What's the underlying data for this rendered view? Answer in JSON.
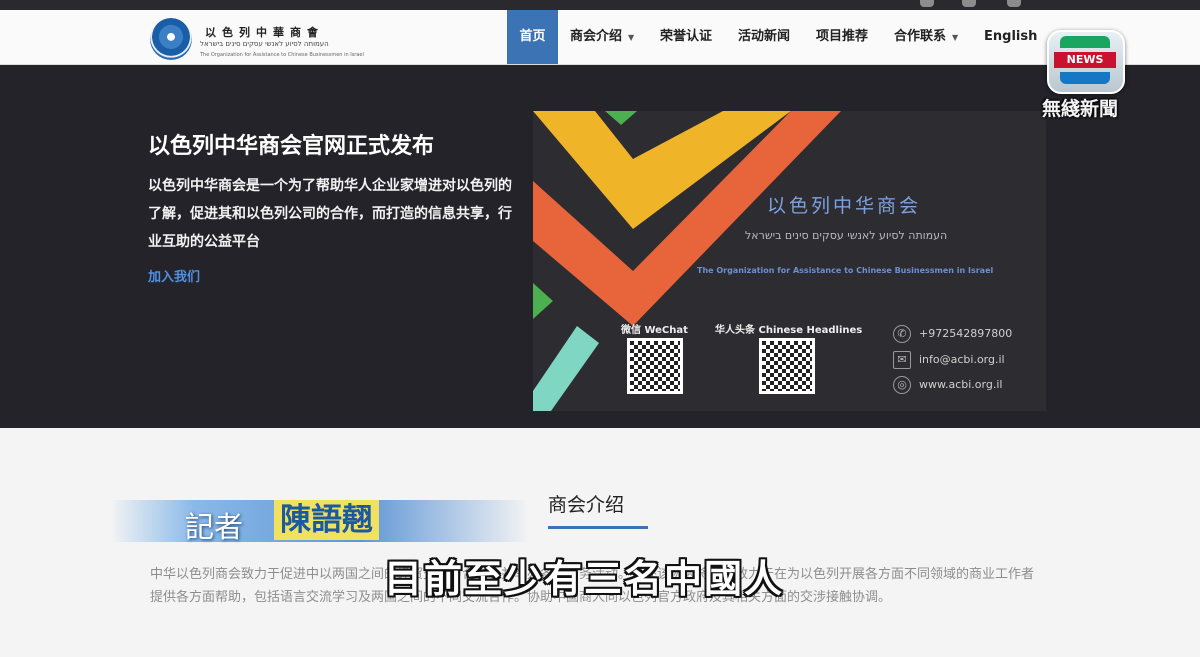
{
  "header": {
    "logo_cn": "以色列中華商會",
    "logo_he": "העמותה לסיוע לאנשי עסקים סינים בישראל",
    "logo_en": "The Organization for Assistance to Chinese Businessmen in Israel",
    "nav": [
      {
        "label": "首页",
        "active": true
      },
      {
        "label": "商会介绍",
        "has_dropdown": true
      },
      {
        "label": "荣誉认证"
      },
      {
        "label": "活动新闻"
      },
      {
        "label": "项目推荐"
      },
      {
        "label": "合作联系",
        "has_dropdown": true
      },
      {
        "label": "English"
      }
    ]
  },
  "hero": {
    "title": "以色列中华商会官网正式发布",
    "description": "以色列中华商会是一个为了帮助华人企业家增进对以色列的了解，促进其和以色列公司的合作，而打造的信息共享，行业互助的公益平台",
    "link": "加入我们"
  },
  "banner": {
    "title_cn": "以色列中华商会",
    "title_he": "העמותה לסיוע לאנשי עסקים סינים בישראל",
    "title_en": "The Organization for Assistance to Chinese Businessmen in Israel",
    "wechat_label": "微信 WeChat",
    "headlines_label": "华人头条 Chinese Headlines",
    "phone": "+972542897800",
    "email": "info@acbi.org.il",
    "website": "www.acbi.org.il",
    "colors": {
      "yellow": "#f0b429",
      "orange": "#e8643a",
      "green": "#4caf50",
      "teal": "#7fd6c2"
    }
  },
  "about": {
    "title": "商会介绍",
    "paragraph": "中华以色列商会致力于促进中以两国之间的经贸交流与合作，并举办各类商务活动。另外该协会将合法致力于在为以色列开展各方面不同领域的商业工作者提供各方面帮助，包括语言交流学习及两国之间的不同交流合作。协助中国商人同以色列官方政府及其相关方面的交涉接触协调。"
  },
  "broadcast": {
    "reporter_label": "記者",
    "reporter_name": "陳語翹",
    "subtitle": "目前至少有三名中國人",
    "channel_badge": "NEWS",
    "channel_name": "無綫新聞"
  },
  "icons": [
    "phone-icon",
    "mail-icon",
    "globe-icon",
    "caret-down-icon"
  ]
}
